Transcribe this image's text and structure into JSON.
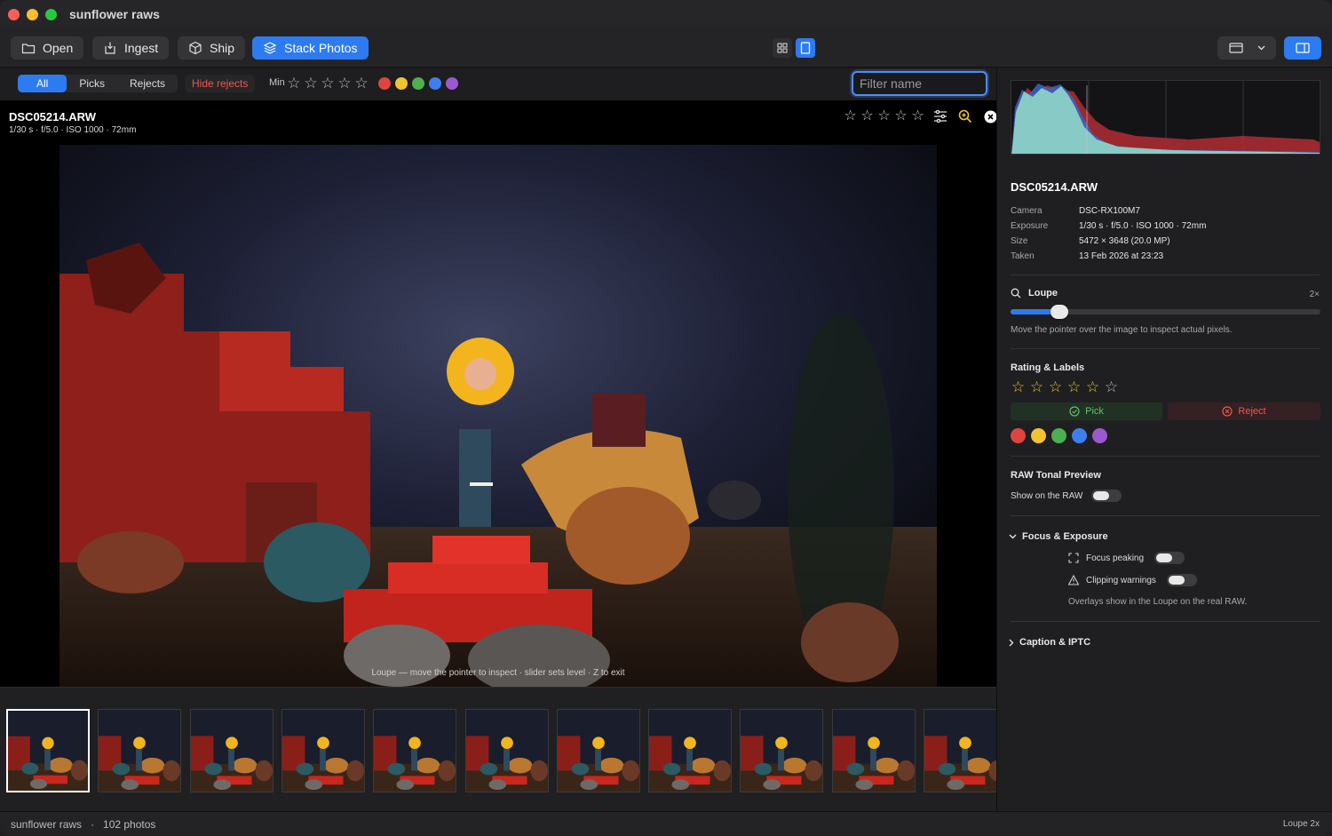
{
  "window": {
    "title": "sunflower raws"
  },
  "toolbar": {
    "open": "Open",
    "ingest": "Ingest",
    "ship": "Ship",
    "stack_photos": "Stack Photos"
  },
  "filter": {
    "tabs": [
      "All",
      "Picks",
      "Rejects"
    ],
    "active_tab": "All",
    "hide_rejects": "Hide rejects",
    "min_label": "Min",
    "min_stars": [
      "☆",
      "☆",
      "☆",
      "☆",
      "☆"
    ],
    "color_labels": [
      "#e0443e",
      "#f0c330",
      "#4caf50",
      "#3d7ff0",
      "#9b59d0"
    ],
    "search_placeholder": "Filter name"
  },
  "viewer": {
    "filename": "DSC05214.ARW",
    "meta": "1/30 s  ·  f/5.0  ·  ISO 1000  ·  72mm",
    "rating_stars": [
      "☆",
      "☆",
      "☆",
      "☆",
      "☆"
    ],
    "loupe_hint": "Loupe — move the pointer to inspect · slider sets level · Z to exit"
  },
  "filmstrip": {
    "count_visible": 11,
    "selected_index": 0
  },
  "status": {
    "left": "sunflower raws   ·   102 photos",
    "right": "Loupe 2x"
  },
  "inspector": {
    "title": "DSC05214.ARW",
    "rows": [
      {
        "k": "Camera",
        "v": "DSC-RX100M7"
      },
      {
        "k": "Exposure",
        "v": "1/30 s  ·  f/5.0  ·  ISO 1000  ·  72mm"
      },
      {
        "k": "Size",
        "v": "5472 × 3648  (20.0 MP)"
      },
      {
        "k": "Taken",
        "v": "13 Feb 2026 at 23:23"
      }
    ],
    "loupe": {
      "title": "Loupe",
      "level": "2×",
      "level_fraction": 0.13,
      "hint": "Move the pointer over the image to inspect actual pixels."
    },
    "rating": {
      "title": "Rating & Labels",
      "stars": [
        "☆",
        "☆",
        "☆",
        "☆",
        "☆"
      ],
      "clear": "☆",
      "pick": "Pick",
      "reject": "Reject",
      "labels": [
        "#e0443e",
        "#f0c330",
        "#4caf50",
        "#3d7ff0",
        "#9b59d0"
      ]
    },
    "raw_tonal": {
      "title": "RAW Tonal Preview",
      "toggle_label": "Show on the RAW",
      "on": false
    },
    "focus": {
      "title": "Focus & Exposure",
      "peaking": "Focus peaking",
      "clipping": "Clipping warnings",
      "hint": "Overlays show in the Loupe on the real RAW."
    },
    "caption": {
      "title": "Caption & IPTC"
    }
  }
}
